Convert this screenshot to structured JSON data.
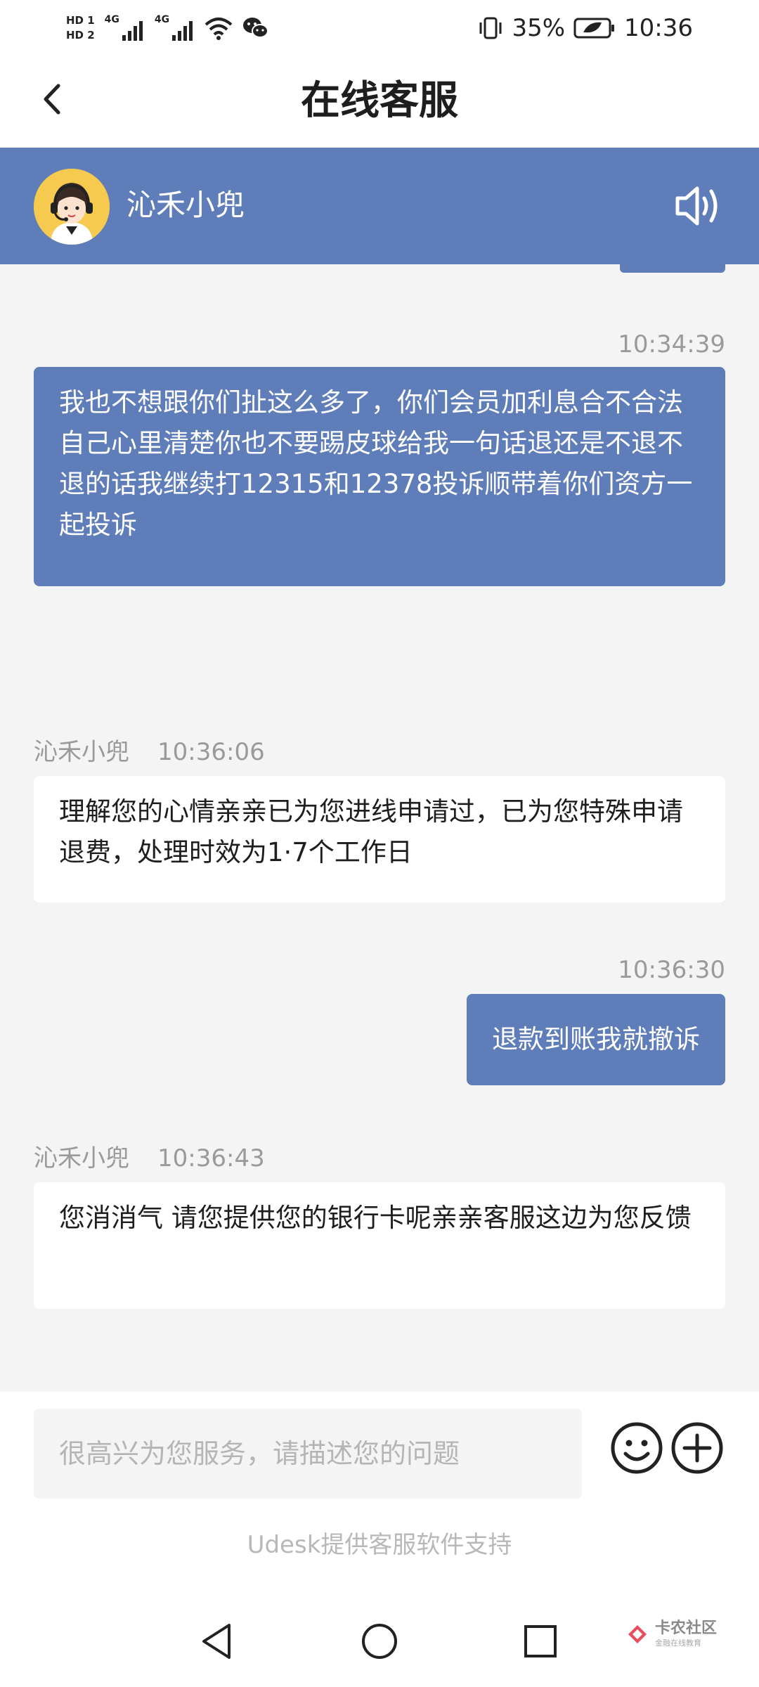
{
  "status_bar": {
    "hd1": "HD 1",
    "hd2": "HD 2",
    "net1": "4G",
    "net2": "4G",
    "battery": "35%",
    "time": "10:36"
  },
  "header": {
    "title": "在线客服"
  },
  "agent": {
    "name": "沁禾小兜"
  },
  "messages": [
    {
      "sender": "user",
      "time": "10:34:39",
      "text": "我也不想跟你们扯这么多了，你们会员加利息合不合法自己心里清楚你也不要踢皮球给我一句话退还是不退不退的话我继续打12315和12378投诉顺带着你们资方一起投诉"
    },
    {
      "sender": "agent",
      "name": "沁禾小兜",
      "time": "10:36:06",
      "text": "理解您的心情亲亲已为您进线申请过，已为您特殊申请退费，处理时效为1·7个工作日"
    },
    {
      "sender": "user",
      "time": "10:36:30",
      "text": "退款到账我就撤诉"
    },
    {
      "sender": "agent",
      "name": "沁禾小兜",
      "time": "10:36:43",
      "text": "您消消气 请您提供您的银行卡呢亲亲客服这边为您反馈"
    }
  ],
  "input": {
    "placeholder": "很高兴为您服务，请描述您的问题",
    "value": ""
  },
  "footer": {
    "powered_by": "Udesk提供客服软件支持"
  },
  "watermark": {
    "main": "卡农社区",
    "sub": "金融在线教育"
  },
  "colors": {
    "accent": "#5f7db8",
    "background": "#f4f4f4",
    "bubble_agent": "#ffffff",
    "muted_text": "#9a9a9a"
  },
  "icons": {
    "back": "chevron-left-icon",
    "speaker": "speaker-icon",
    "emoji": "smiley-icon",
    "plus": "plus-circle-icon",
    "nav_back": "triangle-back-icon",
    "nav_home": "circle-home-icon",
    "nav_recent": "square-recent-icon"
  }
}
